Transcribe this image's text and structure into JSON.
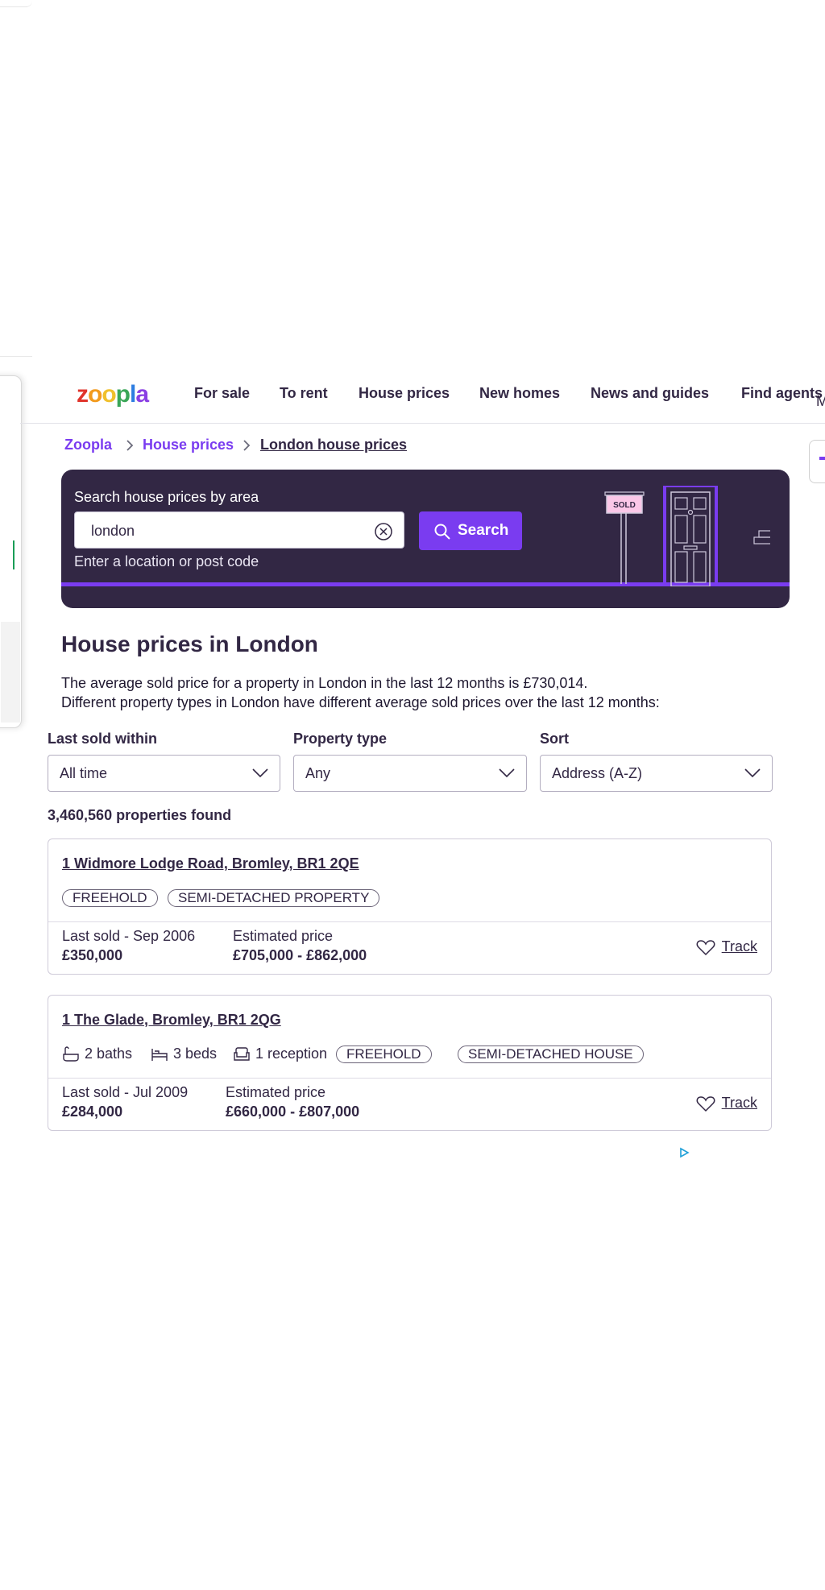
{
  "logo": {
    "text": "zoopla"
  },
  "nav": {
    "items": [
      "For sale",
      "To rent",
      "House prices",
      "New homes",
      "News and guides",
      "Find agents"
    ],
    "overflow_label": "M"
  },
  "breadcrumb": {
    "items": [
      "Zoopla",
      "House prices"
    ],
    "current": "London house prices"
  },
  "hero": {
    "label": "Search house prices by area",
    "input_value": "london",
    "button_label": "Search",
    "hint": "Enter a location or post code",
    "sign_text": "SOLD"
  },
  "main": {
    "title": "House prices in London",
    "intro_line1": "The average sold price for a property in London in the last 12 months is £730,014.",
    "intro_line2": "Different property types in London have different average sold prices over the last 12 months:"
  },
  "filters": {
    "last_sold": {
      "label": "Last sold within",
      "value": "All time"
    },
    "property_type": {
      "label": "Property type",
      "value": "Any"
    },
    "sort": {
      "label": "Sort",
      "value": "Address (A-Z)"
    }
  },
  "results": {
    "count": "3,460,560 properties found",
    "listings": [
      {
        "address": "1 Widmore Lodge Road, Bromley, BR1 2QE",
        "tags": [
          "FREEHOLD",
          "SEMI-DETACHED PROPERTY"
        ],
        "last_sold": "Last sold - Sep 2006",
        "sold_price": "£350,000",
        "est_label": "Estimated price",
        "est_range": "£705,000 - £862,000",
        "track": "Track"
      },
      {
        "address": "1 The Glade, Bromley, BR1 2QG",
        "baths": "2 baths",
        "beds": "3 beds",
        "reception": "1 reception",
        "tags": [
          "FREEHOLD",
          "SEMI-DETACHED HOUSE"
        ],
        "last_sold": "Last sold - Jul 2009",
        "sold_price": "£284,000",
        "est_label": "Estimated price",
        "est_range": "£660,000 - £807,000",
        "track": "Track"
      }
    ]
  },
  "colors": {
    "brand_purple": "#7a3cf0",
    "dark": "#322744",
    "logo_letters": [
      "#e0342b",
      "#f29a1d",
      "#f0c02c",
      "#3aa657",
      "#2d7de1",
      "#8a3fe3"
    ]
  }
}
